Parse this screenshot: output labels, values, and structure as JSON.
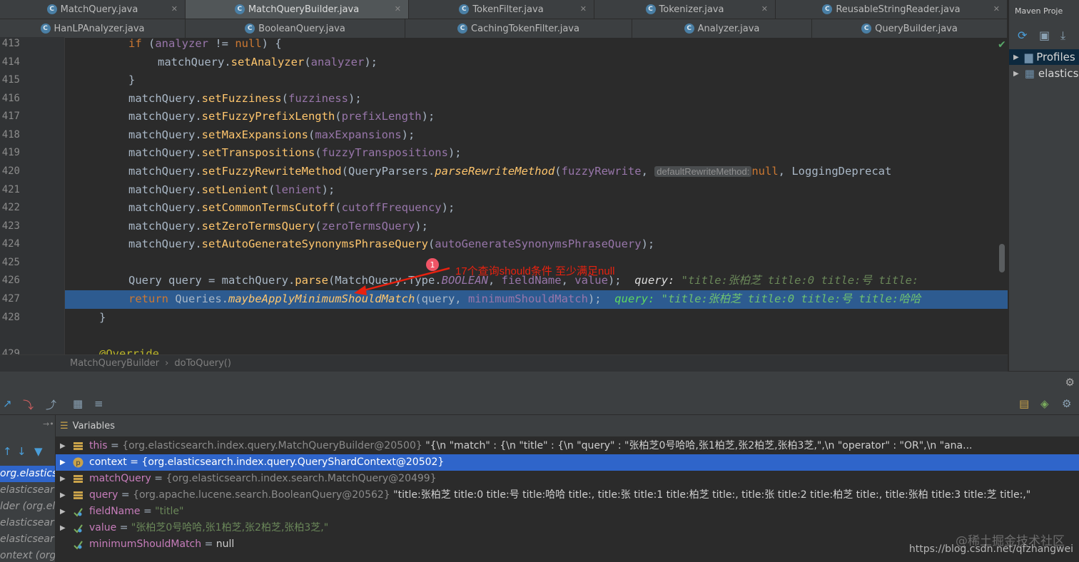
{
  "tabs_row1": [
    {
      "label": "MatchQuery.java",
      "active": false
    },
    {
      "label": "MatchQueryBuilder.java",
      "active": true
    },
    {
      "label": "TokenFilter.java",
      "active": false
    },
    {
      "label": "Tokenizer.java",
      "active": false
    },
    {
      "label": "ReusableStringReader.java",
      "active": false
    }
  ],
  "tabs_row2": [
    {
      "label": "HanLPAnalyzer.java"
    },
    {
      "label": "BooleanQuery.java"
    },
    {
      "label": "CachingTokenFilter.java"
    },
    {
      "label": "Analyzer.java"
    },
    {
      "label": "QueryBuilder.java"
    }
  ],
  "maven": {
    "title": "Maven Proje",
    "items": [
      "Profiles",
      "elastics"
    ]
  },
  "line_numbers": [
    "413",
    "414",
    "415",
    "416",
    "417",
    "418",
    "419",
    "420",
    "421",
    "422",
    "423",
    "424",
    "425",
    "426",
    "427",
    "428",
    "429"
  ],
  "code": {
    "l413": {
      "kw_if": "if",
      "open": " (",
      "var": "analyzer",
      "op": " != ",
      "kw_null": "null",
      "close": ") {"
    },
    "l414": {
      "obj": "matchQuery.",
      "m": "setAnalyzer",
      "a": "(",
      "p": "analyzer",
      "b": ");"
    },
    "l415": "}",
    "l416": {
      "obj": "matchQuery.",
      "m": "setFuzziness",
      "a": "(",
      "p": "fuzziness",
      "b": ");"
    },
    "l417": {
      "obj": "matchQuery.",
      "m": "setFuzzyPrefixLength",
      "a": "(",
      "p": "prefixLength",
      "b": ");"
    },
    "l418": {
      "obj": "matchQuery.",
      "m": "setMaxExpansions",
      "a": "(",
      "p": "maxExpansions",
      "b": ");"
    },
    "l419": {
      "obj": "matchQuery.",
      "m": "setTranspositions",
      "a": "(",
      "p": "fuzzyTranspositions",
      "b": ");"
    },
    "l420": {
      "obj": "matchQuery.",
      "m": "setFuzzyRewriteMethod",
      "a": "(QueryParsers.",
      "m2": "parseRewriteMethod",
      "a2": "(",
      "p": "fuzzyRewrite",
      "c": ", ",
      "hint": "defaultRewriteMethod:",
      "kw_null": "null",
      "rest": ", LoggingDeprecat"
    },
    "l421": {
      "obj": "matchQuery.",
      "m": "setLenient",
      "a": "(",
      "p": "lenient",
      "b": ");"
    },
    "l422": {
      "obj": "matchQuery.",
      "m": "setCommonTermsCutoff",
      "a": "(",
      "p": "cutoffFrequency",
      "b": ");"
    },
    "l423": {
      "obj": "matchQuery.",
      "m": "setZeroTermsQuery",
      "a": "(",
      "p": "zeroTermsQuery",
      "b": ");"
    },
    "l424": {
      "obj": "matchQuery.",
      "m": "setAutoGenerateSynonymsPhraseQuery",
      "a": "(",
      "p": "autoGenerateSynonymsPhraseQuery",
      "b": ");"
    },
    "l426": {
      "pre": "Query query = matchQuery.",
      "m": "parse",
      "a": "(MatchQuery.Type.",
      "c": "BOOLEAN",
      "d": ", ",
      "p1": "fieldName",
      "e": ", ",
      "p2": "value",
      "f": ");",
      "inl_name": "query:",
      "inl_val": "\"title:张柏芝 title:0 title:号 title:"
    },
    "l427": {
      "kw": "return",
      "pre": " Queries.",
      "m": "maybeApplyMinimumShouldMatch",
      "a": "(query, ",
      "p": "minimumShouldMatch",
      "b": ");",
      "inl_name": "query:",
      "inl_val": "\"title:张柏芝 title:0 title:号 title:哈哈"
    },
    "l428": "}",
    "l430": "@Override"
  },
  "annotation": {
    "badge": "1",
    "text": "17个查询should条件 至少满足null"
  },
  "breadcrumb": {
    "cls": "MatchQueryBuilder",
    "sep": "›",
    "method": "doToQuery()"
  },
  "debugger": {
    "variables_label": "Variables",
    "frames": [
      "org.elasticse",
      "elasticsear",
      "lder (org.el",
      "elasticsear",
      "elasticsear",
      "ontext (org"
    ],
    "vars": [
      {
        "name": "this",
        "eq": " = ",
        "type": "{org.elasticsearch.index.query.MatchQueryBuilder@20500}",
        "val": " \"{\\n  \"match\" : {\\n    \"title\" : {\\n      \"query\" : \"张柏芝0号哈哈,张1柏芝,张2柏芝,张柏3芝,\",\\n      \"operator\" : \"OR\",\\n      \"ana...",
        "icon": "field",
        "expand": true
      },
      {
        "name": "context",
        "eq": " = ",
        "type": "{org.elasticsearch.index.query.QueryShardContext@20502}",
        "val": "",
        "icon": "param",
        "expand": true,
        "selected": true
      },
      {
        "name": "matchQuery",
        "eq": " = ",
        "type": "{org.elasticsearch.index.search.MatchQuery@20499}",
        "val": "",
        "icon": "field",
        "expand": true
      },
      {
        "name": "query",
        "eq": " = ",
        "type": "{org.apache.lucene.search.BooleanQuery@20562}",
        "val": " \"title:张柏芝 title:0 title:号 title:哈哈 title:, title:张 title:1 title:柏芝 title:, title:张 title:2 title:柏芝 title:, title:张柏 title:3 title:芝 title:,\"",
        "icon": "field",
        "expand": true
      },
      {
        "name": "fieldName",
        "eq": " = ",
        "type": "",
        "val": "\"title\"",
        "icon": "watch",
        "expand": true
      },
      {
        "name": "value",
        "eq": " = ",
        "type": "",
        "val": "\"张柏芝0号哈哈,张1柏芝,张2柏芝,张柏3芝,\"",
        "icon": "watch",
        "expand": true
      },
      {
        "name": "minimumShouldMatch",
        "eq": " = ",
        "type": "",
        "val": "null",
        "icon": "watch",
        "expand": false
      }
    ]
  },
  "watermark": "@稀土掘金技术社区",
  "url": "https://blog.csdn.net/qfzhangwei",
  "colors": {
    "keyword": "#cc7832",
    "method": "#ffc66d",
    "field": "#9876aa",
    "string": "#6a8759",
    "selection": "#2f65ca",
    "current_line": "#2d5b90"
  }
}
